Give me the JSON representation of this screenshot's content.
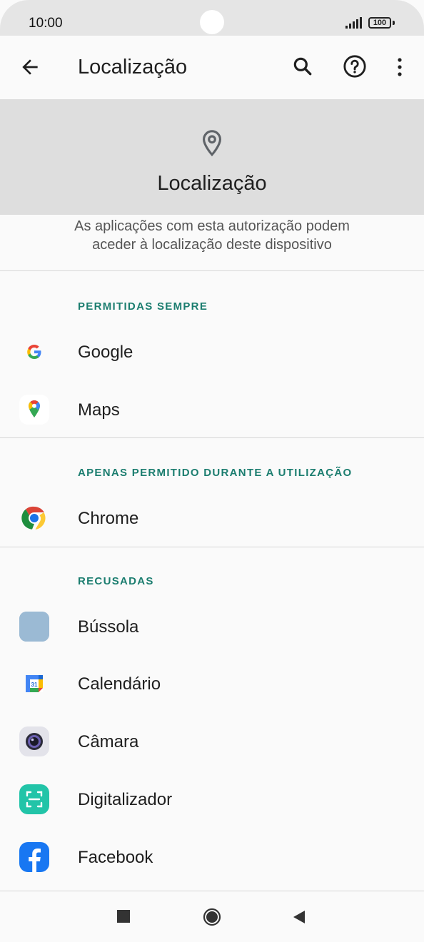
{
  "status_bar": {
    "time": "10:00",
    "battery": "100"
  },
  "app_bar": {
    "title": "Localização",
    "icons": [
      "arrow-back-icon",
      "search-icon",
      "help-icon",
      "more-vert-icon"
    ]
  },
  "header": {
    "title": "Localização",
    "description_line1": "As aplicações com esta autorização podem",
    "description_line2": "aceder à localização deste dispositivo"
  },
  "sections": [
    {
      "title": "PERMITIDAS SEMPRE",
      "apps": [
        {
          "name": "Google"
        },
        {
          "name": "Maps"
        }
      ]
    },
    {
      "title": "APENAS PERMITIDO DURANTE A UTILIZAÇÃO",
      "apps": [
        {
          "name": "Chrome"
        }
      ]
    },
    {
      "title": "RECUSADAS",
      "apps": [
        {
          "name": "Bússola"
        },
        {
          "name": "Calendário"
        },
        {
          "name": "Câmara"
        },
        {
          "name": "Digitalizador"
        },
        {
          "name": "Facebook"
        }
      ]
    }
  ],
  "colors": {
    "accent": "#1b7d6f",
    "header_bg": "#dedede",
    "background": "#fafafa"
  }
}
